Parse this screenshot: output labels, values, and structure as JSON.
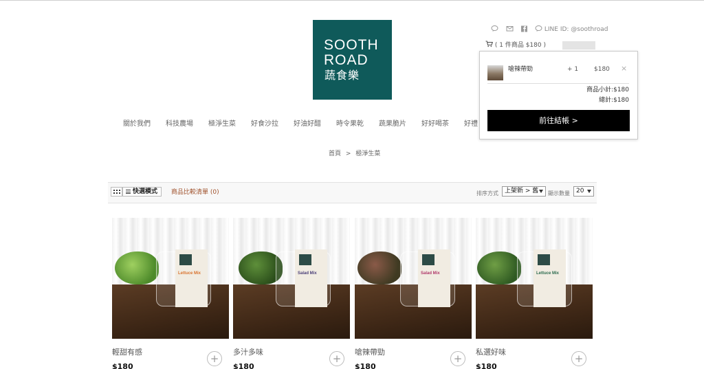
{
  "brand": {
    "line1": "SOOTH",
    "line2": "ROAD",
    "line3": "蔬食樂"
  },
  "util": {
    "line_id": "LINE ID: @soothroad",
    "icons": [
      "chat-icon",
      "mail-icon",
      "facebook-icon",
      "line-icon"
    ]
  },
  "cart": {
    "summary": "( 1 件商品 $180 )"
  },
  "dropdown": {
    "item_name": "嗆辣帶勁",
    "item_qty": "+ 1",
    "item_price": "$180",
    "remove": "×",
    "subtotal": "商品小計:$180",
    "total": "總計:$180",
    "checkout": "前往結帳 >"
  },
  "nav": [
    "關於我們",
    "科技農場",
    "極淨生菜",
    "好食沙拉",
    "好油好醋",
    "時令果乾",
    "蔬果脆片",
    "好好喝茶",
    "好禮"
  ],
  "breadcrumb": {
    "home": "首頁",
    "sep": ">",
    "current": "極淨生菜"
  },
  "toolbar": {
    "quick_mode": "快選模式",
    "compare": "商品比較清單 (0)",
    "sort_label": "排序方式",
    "sort_value": "上架新 > 舊",
    "show_label": "顯示數量",
    "show_value": "20"
  },
  "products": [
    {
      "name": "輕甜有感",
      "price": "$180",
      "label_text": "Lettuce Mix",
      "label_color": "#d9732f"
    },
    {
      "name": "多汁多味",
      "price": "$180",
      "label_text": "Salad Mix",
      "label_color": "#4a3f78"
    },
    {
      "name": "嗆辣帶勁",
      "price": "$180",
      "label_text": "Salad Mix",
      "label_color": "#b0396a"
    },
    {
      "name": "私選好味",
      "price": "$180",
      "label_text": "Lettuce Mix",
      "label_color": "#2d6b4f"
    }
  ],
  "colors": {
    "brand_teal": "#0f5a5a",
    "checkout_bg": "#000000",
    "compare_link": "#a0522d"
  }
}
